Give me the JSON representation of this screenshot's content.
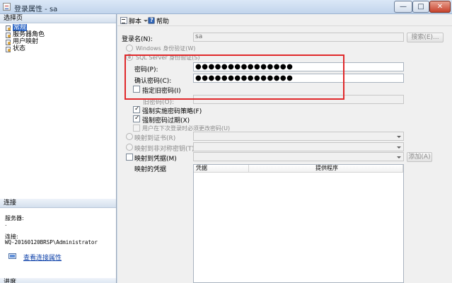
{
  "window": {
    "title": "登录属性 - sa",
    "minimize": "—",
    "maximize": "□",
    "close": "✕"
  },
  "sidebar": {
    "select_page_header": "选择页",
    "items": [
      {
        "label": "常规",
        "selected": true
      },
      {
        "label": "服务器角色",
        "selected": false
      },
      {
        "label": "用户映射",
        "selected": false
      },
      {
        "label": "状态",
        "selected": false
      }
    ],
    "connection_header": "连接",
    "server_label": "服务器:",
    "server_value": ".",
    "connection_label": "连接:",
    "connection_value": "WQ-20160120BRSP\\Administrator",
    "view_connection_link": "查看连接属性",
    "progress_header": "进度"
  },
  "toolbar": {
    "script_label": "脚本",
    "help_label": "帮助"
  },
  "form": {
    "login_name_label": "登录名(N):",
    "login_name_value": "sa",
    "search_button": "搜索(E)...",
    "windows_auth_label": "Windows 身份验证(W)",
    "sql_auth_label": "SQL Server 身份验证(S)",
    "password_label": "密码(P):",
    "password_value": "●●●●●●●●●●●●●●●",
    "confirm_password_label": "确认密码(C):",
    "confirm_password_value": "●●●●●●●●●●●●●●●",
    "specify_old_password_label": "指定旧密码(I)",
    "old_password_label": "旧密码(O):",
    "enforce_policy_label": "强制实施密码策略(F)",
    "enforce_expiration_label": "强制密码过期(X)",
    "must_change_label": "用户在下次登录时必须更改密码(U)",
    "map_certificate_label": "映射到证书(R)",
    "map_asymmetric_key_label": "映射到非对称密钥(T)",
    "map_credential_label": "映射到凭据(M)",
    "add_button": "添加(A)",
    "mapped_credentials_label": "映射的凭据",
    "grid_columns": [
      "凭据",
      "提供程序"
    ]
  },
  "accent": {
    "highlight": "#e0282a",
    "selection": "#3169c6",
    "link": "#0b3fa8"
  }
}
